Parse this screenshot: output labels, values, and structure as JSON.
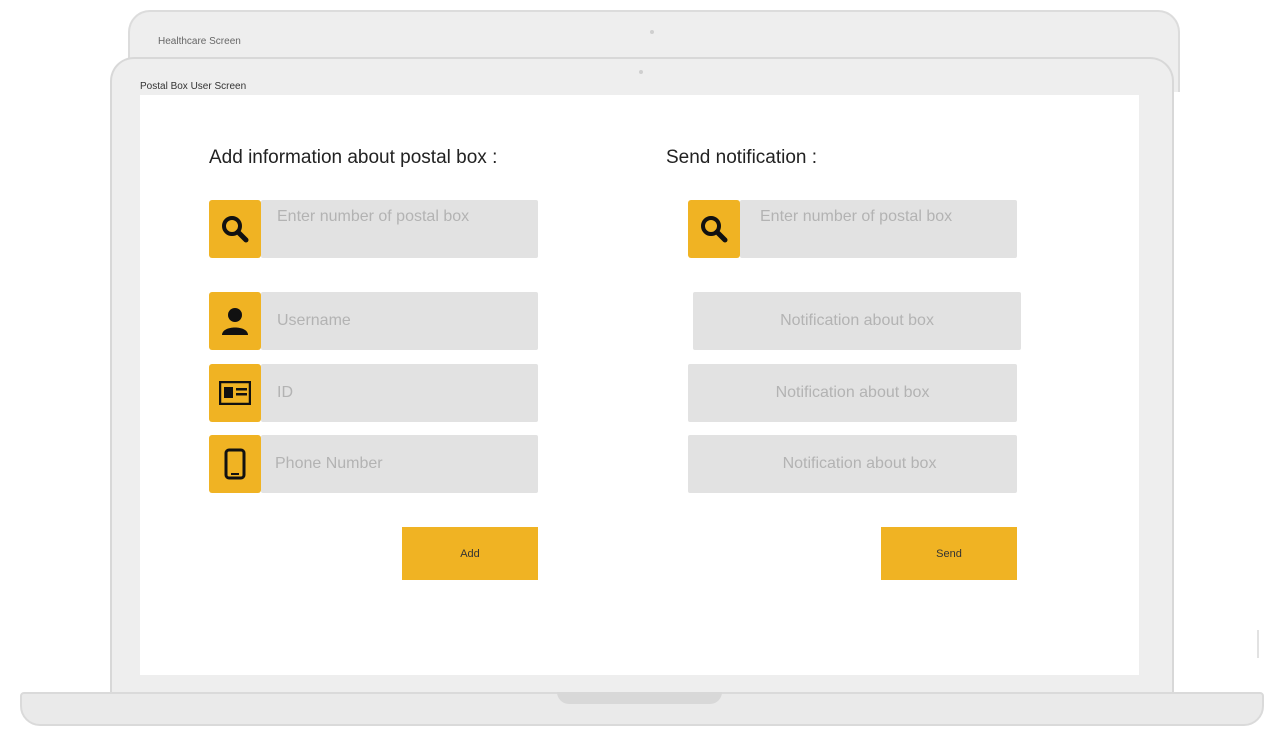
{
  "window": {
    "back_title": "Healthcare Screen",
    "title": "Postal Box User Screen"
  },
  "add_panel": {
    "heading": "Add information about postal box :",
    "search_placeholder": "Enter number of postal box",
    "username_placeholder": "Username",
    "id_placeholder": "ID",
    "phone_placeholder": "Phone Number",
    "add_label": "Add"
  },
  "notify_panel": {
    "heading": "Send notification :",
    "search_placeholder": "Enter number of postal box",
    "notification_1": "Notification about box",
    "notification_2": "Notification about box",
    "notification_3": "Notification about box",
    "send_label": "Send"
  },
  "colors": {
    "accent": "#f0b323",
    "field_bg": "#e2e2e2",
    "placeholder_text": "#b3b3b3",
    "bezel": "#eeeeee"
  },
  "icons": [
    "search-icon",
    "user-icon",
    "id-card-icon",
    "phone-icon"
  ]
}
